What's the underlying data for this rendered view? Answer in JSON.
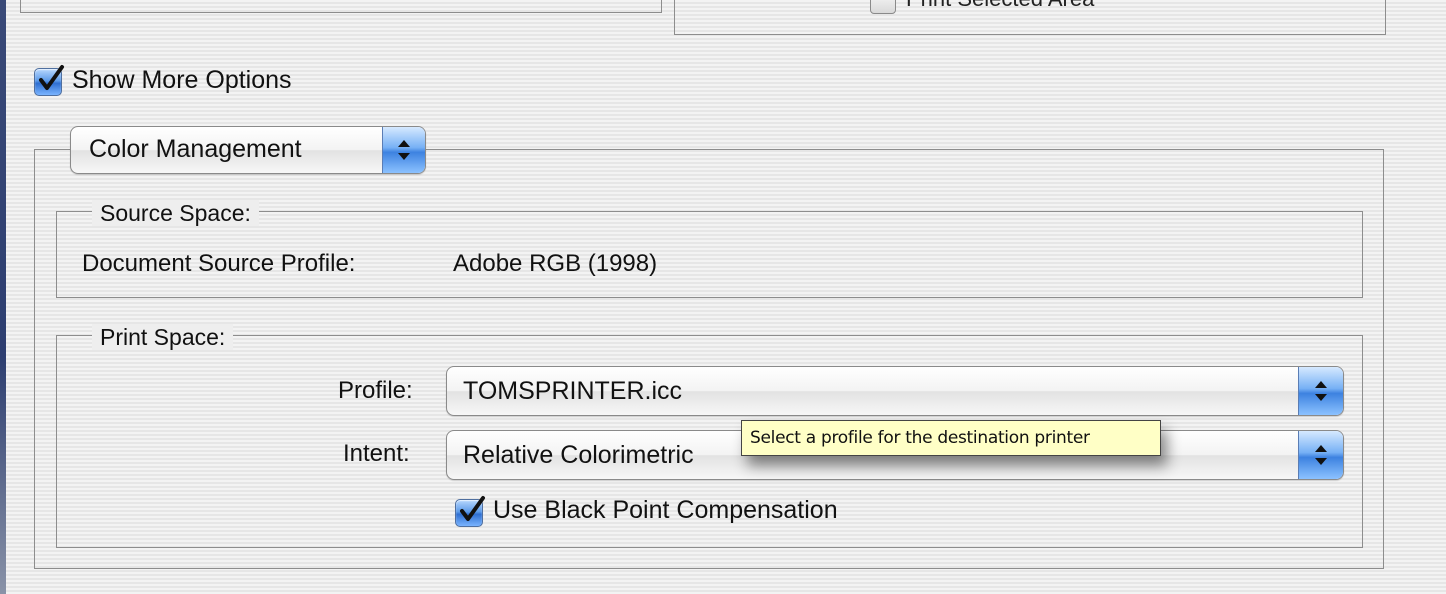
{
  "window": {
    "partial_checkbox_label": "Print Selected Area"
  },
  "options": {
    "show_more_options_label": "Show More Options",
    "show_more_options_checked": true,
    "section_select": {
      "selected": "Color Management"
    }
  },
  "source_space": {
    "legend": "Source Space:",
    "profile_label": "Document Source Profile:",
    "profile_value": "Adobe RGB (1998)"
  },
  "print_space": {
    "legend": "Print Space:",
    "profile_label": "Profile:",
    "profile_value": "TOMSPRINTER.icc",
    "intent_label": "Intent:",
    "intent_value": "Relative Colorimetric",
    "bpc_label": "Use Black Point Compensation",
    "bpc_checked": true
  },
  "tooltip": {
    "text": "Select a profile for the destination printer"
  },
  "icons": {
    "checkmark": "checkmark-icon",
    "popup_arrows": "updown-arrows-icon"
  },
  "colors": {
    "aqua_blue": "#3d82e0",
    "tooltip_bg": "#ffffc6",
    "group_border": "#8d8d8d"
  }
}
